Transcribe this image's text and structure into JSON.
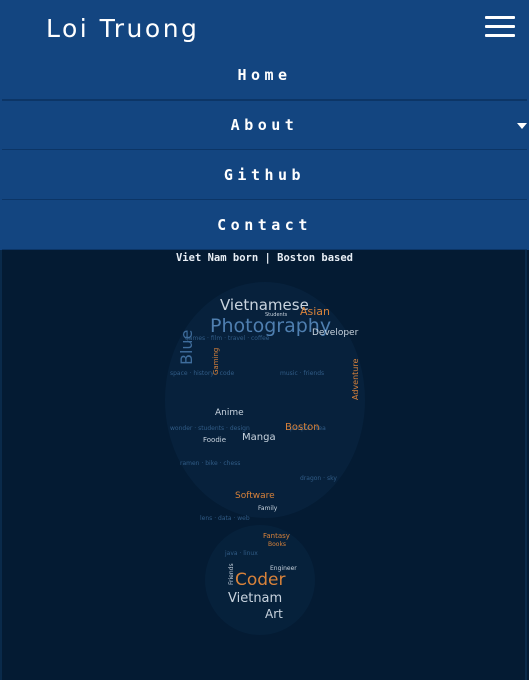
{
  "header": {
    "brand": "Loi Truong"
  },
  "nav": {
    "items": [
      {
        "label": "Home"
      },
      {
        "label": "About"
      },
      {
        "label": "Github"
      },
      {
        "label": "Contact"
      }
    ]
  },
  "tagline": "Viet Nam born | Boston based",
  "word_cloud": {
    "words": [
      "Vietnamese",
      "Photography",
      "Blue",
      "Asian",
      "Developer",
      "Gaming",
      "Adventure",
      "Anime",
      "Manga",
      "Boston",
      "Foodie",
      "Software",
      "Fantasy",
      "Coder",
      "Vietnam",
      "Art",
      "Engineer",
      "Friends",
      "Books",
      "Students",
      "Family"
    ]
  },
  "colors": {
    "header_bg": "#134580",
    "page_bg": "#041b33",
    "nav_divider": "#0c3566",
    "word_orange": "#d8823a",
    "word_blue": "#4f7fb0"
  },
  "icons": {
    "menu": "hamburger-menu-icon",
    "dropdown": "caret-down-icon"
  }
}
